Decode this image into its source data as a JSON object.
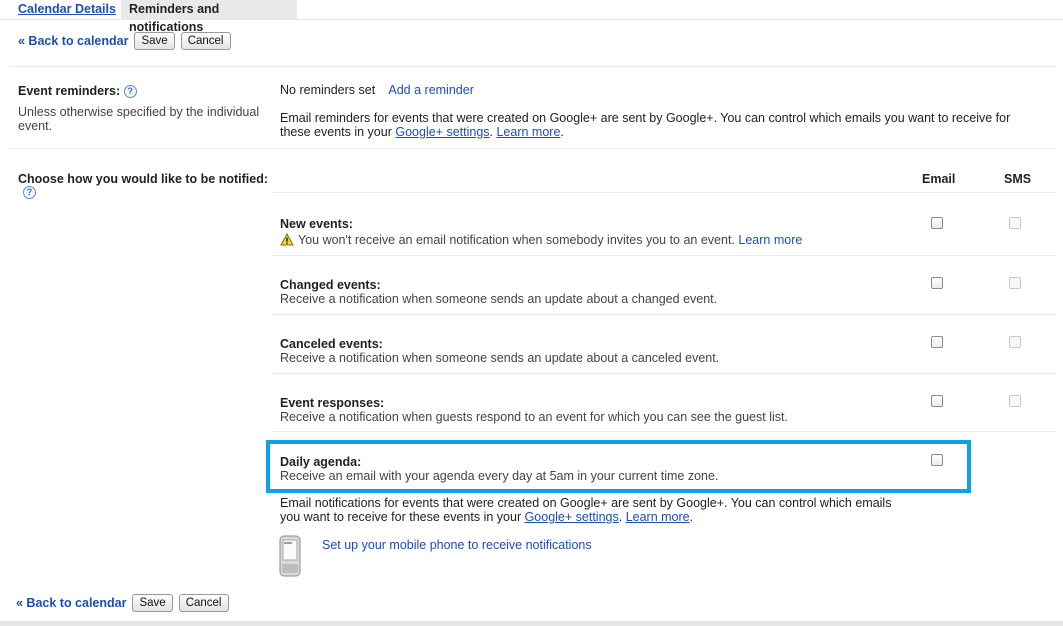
{
  "tabs": {
    "calendar_details": "Calendar Details",
    "reminders": "Reminders and notifications"
  },
  "actions": {
    "back": "« Back to calendar",
    "save": "Save",
    "cancel": "Cancel"
  },
  "event_reminders": {
    "label": "Event reminders:",
    "help": "?",
    "description": "Unless otherwise specified by the individual event.",
    "status": "No reminders set",
    "add_link": "Add a reminder",
    "note_pre": "Email reminders for events that were created on Google+ are sent by Google+. You can control which emails you want to receive for these events in your ",
    "settings_link": "Google+ settings",
    "note_mid": ". ",
    "learn_more": "Learn more",
    "note_end": "."
  },
  "notifications": {
    "label": "Choose how you would like to be notified:",
    "help": "?",
    "col_email": "Email",
    "col_sms": "SMS",
    "rows": [
      {
        "title": "New events:",
        "desc": "You won't receive an email notification when somebody invites you to an event.",
        "link": "Learn more",
        "email_checked": false,
        "sms_checked": false
      },
      {
        "title": "Changed events:",
        "desc": "Receive a notification when someone sends an update about a changed event.",
        "email_checked": false,
        "sms_checked": false
      },
      {
        "title": "Canceled events:",
        "desc": "Receive a notification when someone sends an update about a canceled event.",
        "email_checked": false,
        "sms_checked": false
      },
      {
        "title": "Event responses:",
        "desc": "Receive a notification when guests respond to an event for which you can see the guest list.",
        "email_checked": false,
        "sms_checked": false
      },
      {
        "title": "Daily agenda:",
        "desc": "Receive an email with your agenda every day at 5am in your current time zone.",
        "email_checked": false
      }
    ],
    "footer_note_line1": "Email notifications for events that were created on Google+ are sent by Google+. You can control which emails",
    "footer_note_line2_pre": "you want to receive for these events in your ",
    "settings_link": "Google+ settings",
    "learn_more": "Learn more",
    "mobile_link": "Set up your mobile phone to receive notifications"
  },
  "colors": {
    "highlight": "#0fa0ea",
    "link": "#1a4fb5"
  }
}
